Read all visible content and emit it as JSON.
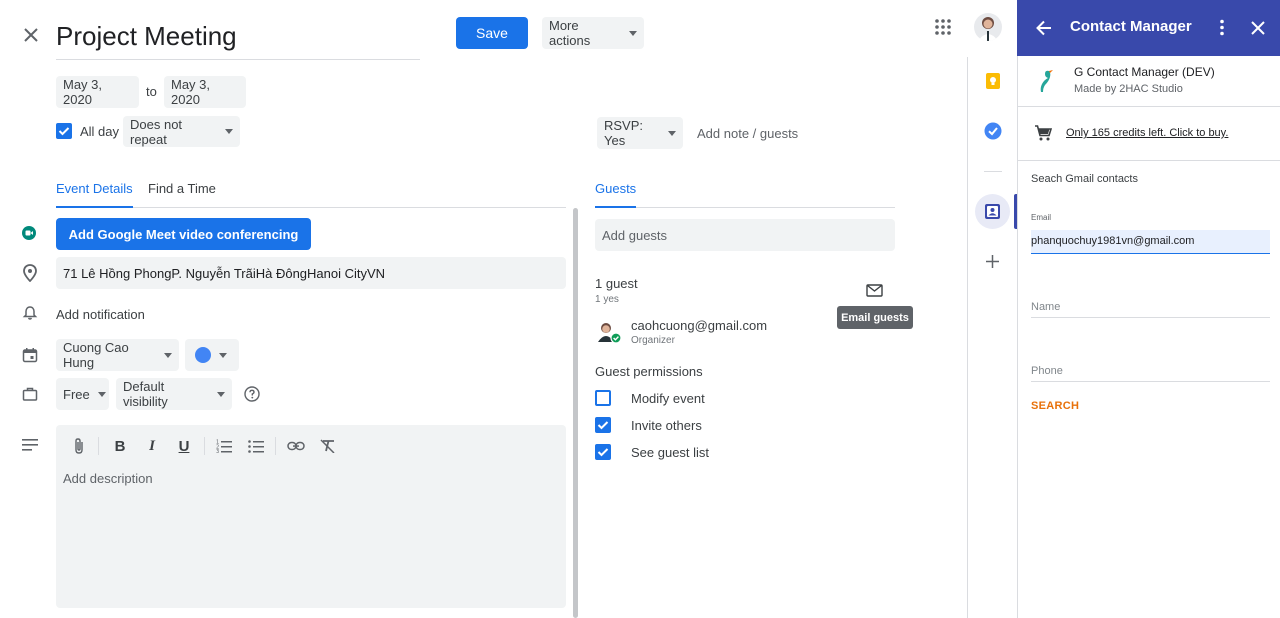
{
  "header": {
    "title": "Project Meeting",
    "save_label": "Save",
    "more_actions_label": "More actions"
  },
  "dates": {
    "start": "May 3, 2020",
    "to_label": "to",
    "end": "May 3, 2020",
    "all_day_label": "All day",
    "repeat": "Does not repeat"
  },
  "rsvp": {
    "value": "RSVP: Yes",
    "note_placeholder": "Add note / guests"
  },
  "tabs": {
    "event_details": "Event Details",
    "find_time": "Find a Time",
    "guests": "Guests"
  },
  "details": {
    "meet_button": "Add Google Meet video conferencing",
    "location": "71 Lê Hồng PhongP. Nguyễn TrãiHà ĐôngHanoi CityVN",
    "notification": "Add notification",
    "calendar": "Cuong Cao Hung",
    "availability": "Free",
    "visibility": "Default visibility",
    "description_placeholder": "Add description"
  },
  "guests": {
    "add_placeholder": "Add guests",
    "count": "1 guest",
    "yes_count": "1 yes",
    "email_tooltip": "Email guests",
    "guest_email": "caohcuong@gmail.com",
    "guest_role": "Organizer",
    "permissions_title": "Guest permissions",
    "permissions": [
      {
        "label": "Modify event",
        "checked": false
      },
      {
        "label": "Invite others",
        "checked": true
      },
      {
        "label": "See guest list",
        "checked": true
      }
    ]
  },
  "sidepanel": {
    "title": "Contact Manager",
    "app_name": "G Contact Manager (DEV)",
    "app_author": "Made by 2HAC Studio",
    "credits_text": "Only 165 credits left. Click to buy.",
    "search_title": "Seach Gmail contacts",
    "email_label": "Email",
    "email_value": "phanquochuy1981vn@gmail.com",
    "name_placeholder": "Name",
    "phone_placeholder": "Phone",
    "search_button": "SEARCH"
  },
  "colors": {
    "primary": "#1a73e8",
    "panel_header": "#3949ab",
    "search_orange": "#e8710a",
    "meet_green": "#00897b"
  }
}
